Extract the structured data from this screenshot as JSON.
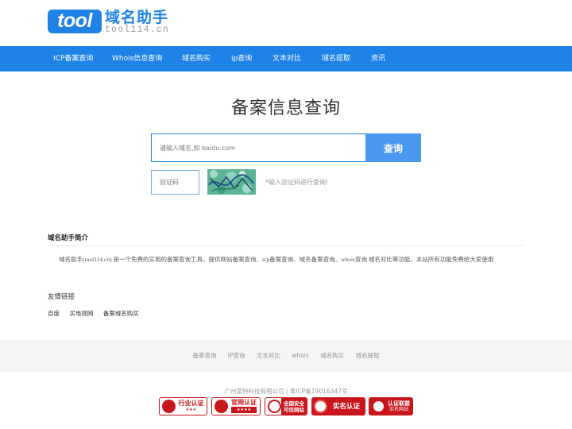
{
  "logo": {
    "mark": "tool",
    "name": "域名助手",
    "domain": "tool114.cn"
  },
  "nav": {
    "items": [
      "ICP备案查询",
      "Whois信息查询",
      "域名购买",
      "ip查询",
      "文本对比",
      "域名提取",
      "资讯"
    ]
  },
  "search": {
    "title": "备案信息查询",
    "placeholder": "请输入域名,如 baidu.com",
    "button": "查询",
    "captcha_placeholder": "验证码",
    "captcha_hint": "*输入验证码进行查询!"
  },
  "intro": {
    "title": "域名助手简介",
    "text": "域名助手(tool114.cn) 是一个免费的实用的备案查询工具，提供网站备案查询、icp备案查询、域名备案查询、whois查询 域名对比等功能，本站所有功能免费给大家使用"
  },
  "friends": {
    "title": "友情链接",
    "links": [
      "百度",
      "买电视网",
      "备案域名购买"
    ]
  },
  "footer": {
    "links": [
      "备案查询",
      "IP查询",
      "文本对比",
      "whois",
      "域名购买",
      "域名提取"
    ],
    "copyright": "广州富特科技有限公司 | 粤ICP备19016347号",
    "badges": [
      {
        "label": "行业认证",
        "sub": "★★★",
        "color": "#c8161d"
      },
      {
        "label": "官网认证",
        "sub": "★★★★",
        "color": "#c8161d"
      },
      {
        "label": "全国安全",
        "sub": "可信网站",
        "color": "#c8161d"
      },
      {
        "label": "实名认证",
        "sub": "",
        "color": "#c8161d"
      },
      {
        "label": "认证联盟",
        "sub": "实名网站",
        "color": "#c8161d"
      }
    ]
  },
  "colors": {
    "brand": "#1e82e6",
    "button": "#4a97f0",
    "badge_red": "#c8161d"
  }
}
